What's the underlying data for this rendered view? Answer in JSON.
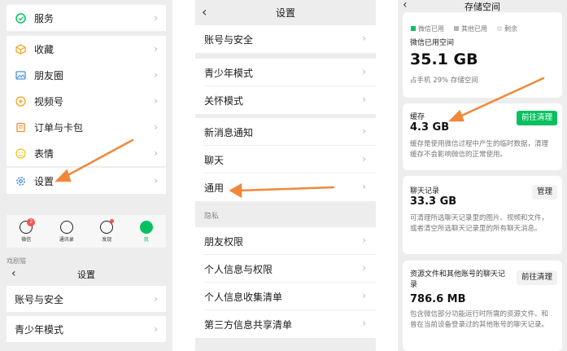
{
  "colors": {
    "accent": "#07c160",
    "arrow": "#f0883a",
    "badge": "#fa5151"
  },
  "panel1": {
    "menu": [
      {
        "label": "服务",
        "icon": "service-icon"
      },
      {
        "label": "收藏",
        "icon": "favorites-icon"
      },
      {
        "label": "朋友圈",
        "icon": "moments-icon"
      },
      {
        "label": "视频号",
        "icon": "channels-icon"
      },
      {
        "label": "订单与卡包",
        "icon": "orders-icon"
      },
      {
        "label": "表情",
        "icon": "sticker-icon"
      },
      {
        "label": "设置",
        "icon": "gear-icon"
      }
    ],
    "chevron": "›",
    "tabs": [
      {
        "label": "微信",
        "badge": "2"
      },
      {
        "label": "通讯录",
        "badge": ""
      },
      {
        "label": "发现",
        "badge": ""
      },
      {
        "label": "我",
        "badge": ""
      }
    ],
    "sub_label": "戏剧猫",
    "sub_nav_title": "设置",
    "back": "‹",
    "sub_rows": [
      "账号与安全",
      "青少年模式"
    ]
  },
  "panel2": {
    "title": "设置",
    "back": "‹",
    "rows": [
      "账号与安全",
      "青少年模式",
      "关怀模式",
      "新消息通知",
      "聊天",
      "通用"
    ],
    "section_label": "隐私",
    "privacy_rows": [
      "朋友权限",
      "个人信息与权限",
      "个人信息收集清单",
      "第三方信息共享清单"
    ],
    "chevron": "›"
  },
  "panel3": {
    "title": "存储空间",
    "back": "‹",
    "legend": [
      "微信已用",
      "其他已用",
      "剩余"
    ],
    "used": {
      "label": "微信已用空间",
      "value": "35.1 GB",
      "sub": "占手机 29% 存储空间"
    },
    "cache": {
      "title": "缓存",
      "value": "4.3 GB",
      "desc": "缓存是使用微信过程中产生的临时数据，清理缓存不会影响微信的正常使用。",
      "button": "前往清理"
    },
    "chat": {
      "title": "聊天记录",
      "value": "33.3 GB",
      "desc": "可清理所选聊天记录里的图片、视频和文件，或者清空所选聊天记录里的所有聊天消息。",
      "button": "管理"
    },
    "files": {
      "title": "资源文件和其他账号的聊天记录",
      "value": "786.6 MB",
      "desc": "包含微信部分功能运行时所需的资源文件、和曾在当前设备登录过的其他账号的聊天记录。",
      "button": "前往清理"
    }
  }
}
